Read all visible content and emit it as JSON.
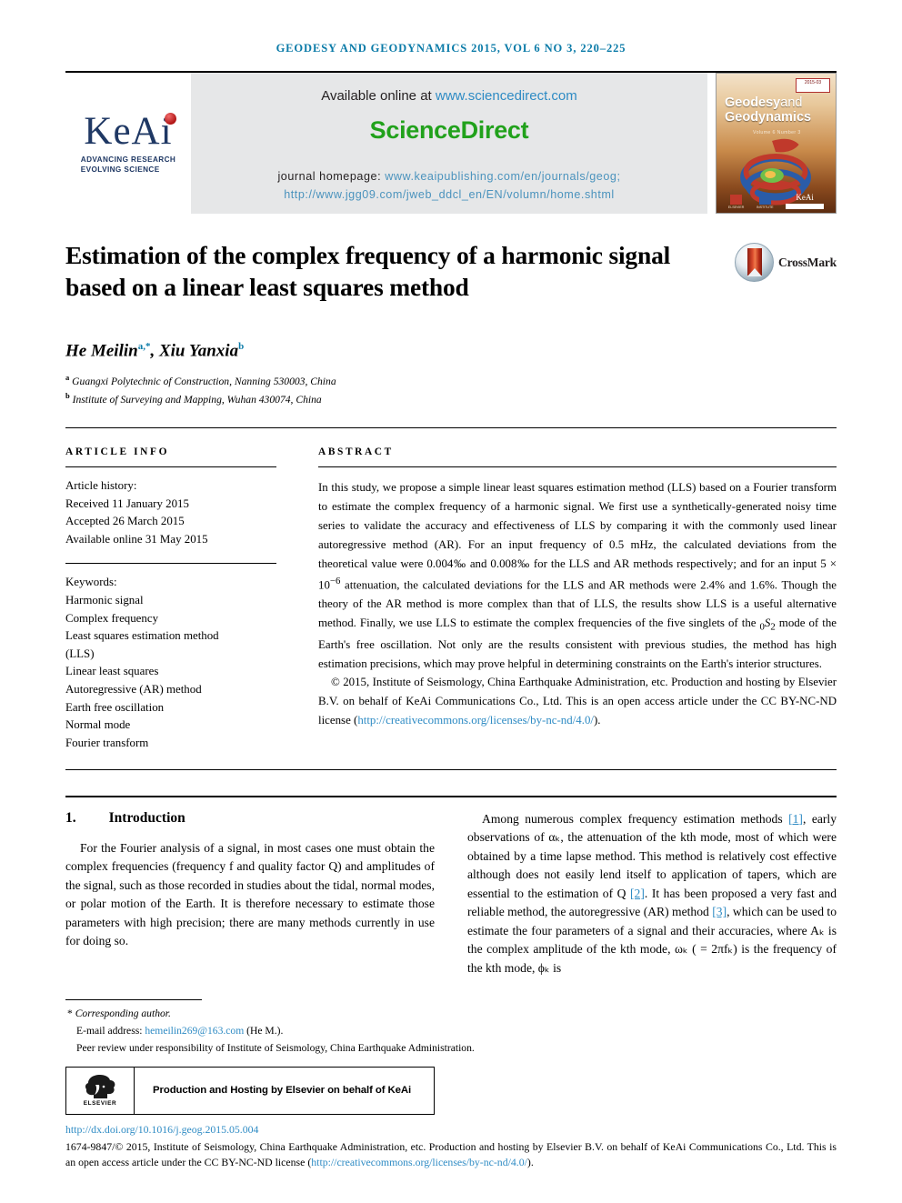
{
  "runhead": "GEODESY AND GEODYNAMICS 2015, VOL 6 NO 3, 220–225",
  "masthead": {
    "logo": {
      "name": "KeAi",
      "tagline_line1": "ADVANCING RESEARCH",
      "tagline_line2": "EVOLVING SCIENCE"
    },
    "available_label": "Available online at",
    "available_link": "www.sciencedirect.com",
    "sciencedirect": "ScienceDirect",
    "homepage_label": "journal homepage:",
    "homepage_link1": "www.keaipublishing.com/en/journals/geog;",
    "homepage_link2": "http://www.jgg09.com/jweb_ddcl_en/EN/volumn/home.shtml",
    "cover": {
      "badge": "2015-03",
      "title_line1": "Geodesy",
      "title_line1_and": "and",
      "title_line2": "Geodynamics",
      "subtitle": "Volume 6    Number 3",
      "foot_keai": "KeAi"
    }
  },
  "article": {
    "title": "Estimation of the complex frequency of a harmonic signal based on a linear least squares method",
    "crossmark_label": "CrossMark",
    "authors_plain": "He Meilin",
    "author1": "He Meilin",
    "author1_sup": "a,*",
    "author2": "Xiu Yanxia",
    "author2_sup": "b",
    "affiliations": [
      {
        "sup": "a",
        "text": "Guangxi Polytechnic of Construction, Nanning 530003, China"
      },
      {
        "sup": "b",
        "text": "Institute of Surveying and Mapping, Wuhan 430074, China"
      }
    ]
  },
  "info": {
    "heading": "ARTICLE INFO",
    "history_label": "Article history:",
    "history": [
      "Received 11 January 2015",
      "Accepted 26 March 2015",
      "Available online 31 May 2015"
    ],
    "keywords_label": "Keywords:",
    "keywords": [
      "Harmonic signal",
      "Complex frequency",
      "Least squares estimation method",
      "(LLS)",
      "Linear least squares",
      "Autoregressive (AR) method",
      "Earth free oscillation",
      "Normal mode",
      "Fourier transform"
    ]
  },
  "abstract": {
    "heading": "ABSTRACT",
    "paragraph1_a": "In this study, we propose a simple linear least squares estimation method (LLS) based on a Fourier transform to estimate the complex frequency of a harmonic signal. We first use a synthetically-generated noisy time series to validate the accuracy and effectiveness of LLS by comparing it with the commonly used linear autoregressive method (AR). For an input frequency of 0.5 mHz, the calculated deviations from the theoretical value were 0.004‰ and 0.008‰ for the LLS and AR methods respectively; and for an input 5 × 10",
    "exp1": "−6",
    "paragraph1_b": " attenuation, the calculated deviations for the LLS and AR methods were 2.4% and 1.6%. Though the theory of the AR method is more complex than that of LLS, the results show LLS is a useful alternative method. Finally, we use LLS to estimate the complex frequencies of the five singlets of the ",
    "mode_pre": "0",
    "mode_letter": "S",
    "mode_post": "2",
    "paragraph1_c": " mode of the Earth's free oscillation. Not only are the results consistent with previous studies, the method has high estimation precisions, which may prove helpful in determining constraints on the Earth's interior structures.",
    "paragraph2": "© 2015, Institute of Seismology, China Earthquake Administration, etc. Production and hosting by Elsevier B.V. on behalf of KeAi Communications Co., Ltd. This is an open access article under the CC BY-NC-ND license (",
    "paragraph2_link": "http://creativecommons.org/licenses/by-nc-nd/4.0/",
    "paragraph2_end": ")."
  },
  "body": {
    "section_number": "1.",
    "section_title": "Introduction",
    "left_paragraph": "For the Fourier analysis of a signal, in most cases one must obtain the complex frequencies (frequency f and quality factor Q) and amplitudes of the signal, such as those recorded in studies about the tidal, normal modes, or polar motion of the Earth. It is therefore necessary to estimate those parameters with high precision; there are many methods currently in use for doing so.",
    "right_a": "Among numerous complex frequency estimation methods ",
    "right_ref1": "[1]",
    "right_b": ", early observations of αₖ, the attenuation of the kth mode, most of which were obtained by a time lapse method. This method is relatively cost effective although does not easily lend itself to application of tapers, which are essential to the estimation of Q ",
    "right_ref2": "[2]",
    "right_c": ". It has been proposed a very fast and reliable method, the autoregressive (AR) method ",
    "right_ref3": "[3]",
    "right_d": ", which can be used to estimate the four parameters of a signal and their accuracies, where Aₖ is the complex amplitude of the kth mode, ωₖ ( = 2πfₖ) is the frequency of the kth mode, ϕₖ is"
  },
  "footer": {
    "corresponding": "Corresponding author.",
    "email_label": "E-mail address:",
    "email": "hemeilin269@163.com",
    "email_suffix": "(He M.).",
    "peer_review": "Peer review under responsibility of Institute of Seismology, China Earthquake Administration.",
    "elsevier_word": "ELSEVIER",
    "hosting_text": "Production and Hosting by Elsevier on behalf of KeAi",
    "doi": "http://dx.doi.org/10.1016/j.geog.2015.05.004",
    "copyright_a": "1674-9847/© 2015, Institute of Seismology, China Earthquake Administration, etc. Production and hosting by Elsevier B.V. on behalf of KeAi Communications Co., Ltd. This is an open access article under the CC BY-NC-ND license (",
    "copyright_link": "http://creativecommons.org/licenses/by-nc-nd/4.0/",
    "copyright_end": ")."
  },
  "colors": {
    "runhead": "#0b7ba8",
    "link": "#2e8bc4",
    "sciencedirect_green": "#21a11b",
    "keai_navy": "#1f3864",
    "keai_red": "#b01414",
    "masthead_bg": "#e6e7e8"
  }
}
